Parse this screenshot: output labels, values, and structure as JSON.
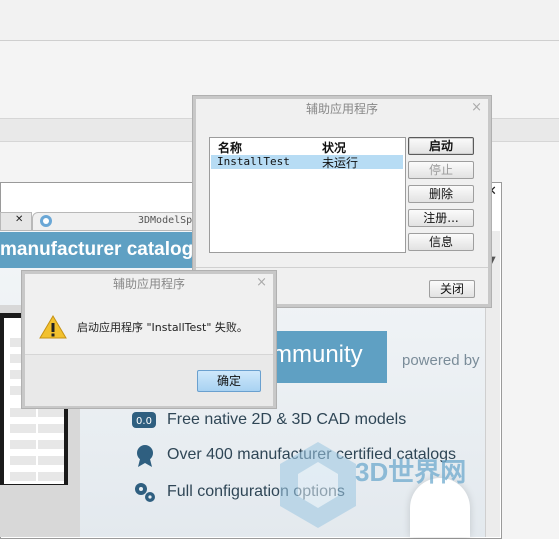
{
  "browser": {
    "tab_close": "✕",
    "tab_title": "3DModelSpa",
    "window_close": "✕"
  },
  "web": {
    "banner_text": "manufacturer catalogs  r",
    "community_text": "mmunity",
    "powered_text": "powered by",
    "features": [
      {
        "icon": "cad-badge-icon",
        "text": "Free native 2D & 3D CAD models"
      },
      {
        "icon": "certified-medal-icon",
        "text": "Over 400 manufacturer certified catalogs"
      },
      {
        "icon": "gears-icon",
        "text": "Full configuration options"
      }
    ],
    "watermark": "3D世界网",
    "accent_color": "#5fa0c3"
  },
  "aux_dialog": {
    "title": "辅助应用程序",
    "close": "×",
    "columns": [
      "名称",
      "状况"
    ],
    "rows": [
      {
        "name": "InstallTest",
        "status": "未运行"
      }
    ],
    "buttons": {
      "start": "启动",
      "stop": "停止",
      "delete": "删除",
      "register": "注册...",
      "info": "信息",
      "close": "关闭"
    }
  },
  "error_dialog": {
    "title": "辅助应用程序",
    "close": "×",
    "message": "启动应用程序 \"InstallTest\" 失败。",
    "ok": "确定",
    "icon": "warning-icon"
  }
}
